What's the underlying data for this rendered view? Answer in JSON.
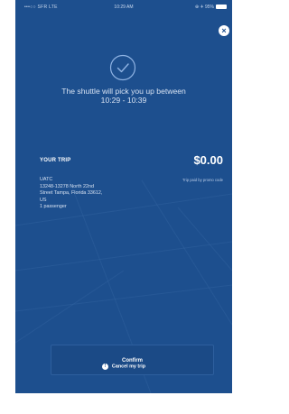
{
  "status_bar": {
    "carrier": "•••○○ SFR  LTE",
    "time": "10:29 AM",
    "right": "⊕ ✈ 95%"
  },
  "close_icon": "×",
  "checkmark_icon": "check-circle-icon",
  "message": {
    "line1": "The shuttle will pick you up between",
    "line2": "10:29 - 10:39"
  },
  "trip": {
    "label": "YOUR TRIP",
    "price": "$0.00",
    "promo_note": "Trip paid by promo code",
    "destination": "UATC",
    "address_line1": "13248-13278 North 22nd",
    "address_line2": "Street Tampa, Florida 33612,",
    "address_line3": "US",
    "passengers": "1 passenger"
  },
  "confirm_label": "Confirm",
  "cancel": {
    "icon": "!",
    "label": "Cancel my trip"
  },
  "colors": {
    "background": "#1d4f8e",
    "button": "#1b4a86",
    "text": "#ffffff"
  }
}
